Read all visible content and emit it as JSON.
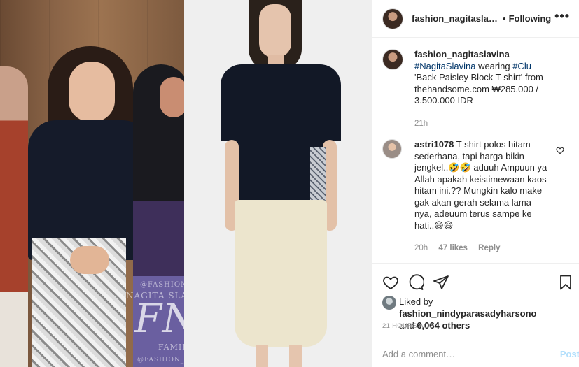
{
  "post": {
    "username": "fashion_nagitaslavina",
    "follow_label": "Following",
    "more_label": "•••",
    "caption": {
      "username": "fashion_nagitaslavina",
      "tag1": "#NagitaSlavina",
      "text1": " wearing ",
      "tag2": "#Clu",
      "text2": " 'Back Paisley Block T-shirt' from thehandsome.com ₩285.000 / 3.500.000 IDR",
      "time": "21h"
    },
    "comments": [
      {
        "username": "astri1078",
        "text": " T shirt polos hitam sederhana, tapi harga bikin jengkel..🤣🤣 aduuh Ampuun ya Allah apakah keistimewaan kaos hitam ini.?? Mungkin kalo make gak akan gerah selama lama nya, adeuum terus sampe ke hati..😄😄",
        "time": "20h",
        "likes": "47 likes",
        "reply_label": "Reply"
      }
    ],
    "likes": {
      "prefix": "Liked by ",
      "user": "fashion_nindyparasadyharsono",
      "middle": " and ",
      "others": "6,064 others"
    },
    "timestamp": "21 HOURS AGO",
    "add_comment_placeholder": "Add a comment…",
    "post_label": "Post"
  },
  "photo": {
    "watermark_handle": "@FASHION_NAGITASLAVINA",
    "watermark_name": "NAGITA SLAVINA",
    "watermark_logo": "FNS",
    "watermark_family": "FAMILY",
    "watermark_bottom": "@FASHION_NAGITASLAVINA"
  },
  "colors": {
    "link": "#003569",
    "muted": "#8e8e8e",
    "post_disabled": "#b2dffc"
  }
}
